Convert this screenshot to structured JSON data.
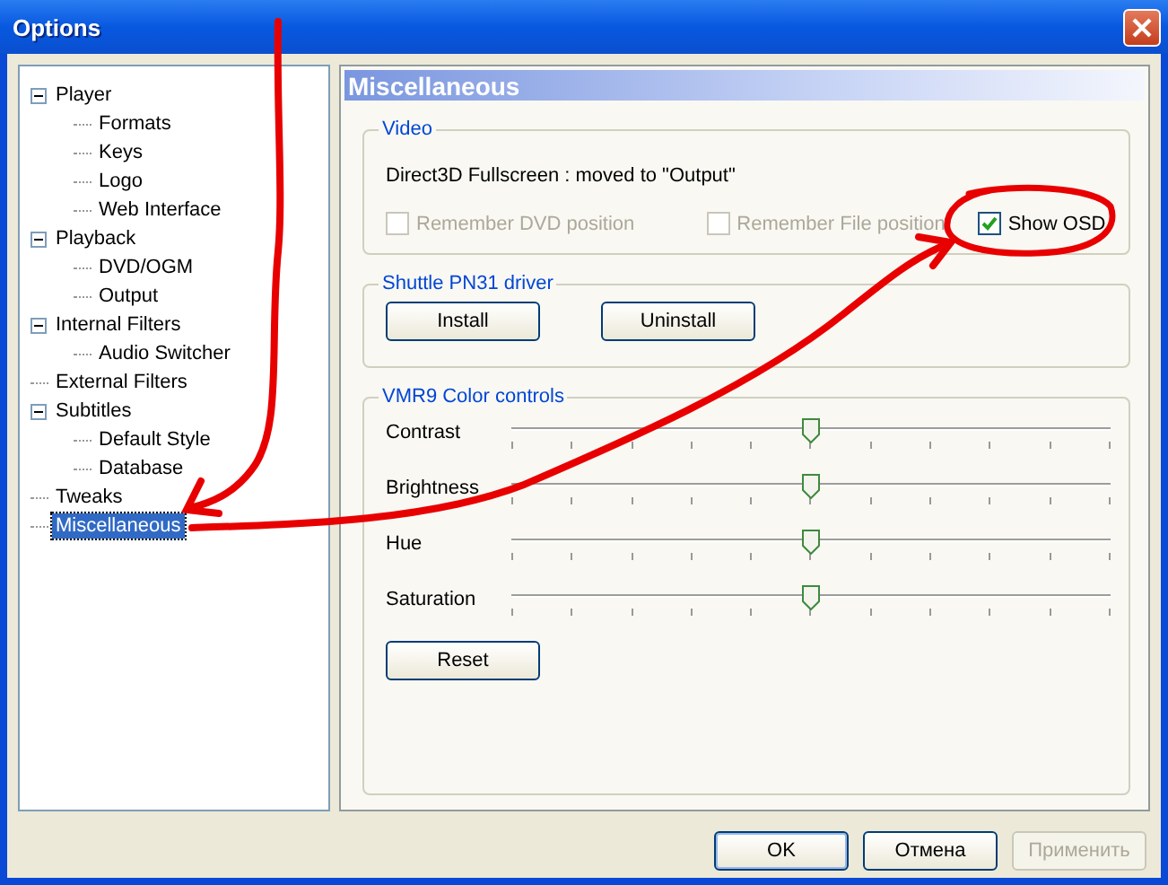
{
  "window": {
    "title": "Options"
  },
  "tree": [
    {
      "label": "Player",
      "expanded": true,
      "selected": false,
      "children": [
        {
          "label": "Formats",
          "selected": false
        },
        {
          "label": "Keys",
          "selected": false
        },
        {
          "label": "Logo",
          "selected": false
        },
        {
          "label": "Web Interface",
          "selected": false
        }
      ]
    },
    {
      "label": "Playback",
      "expanded": true,
      "selected": false,
      "children": [
        {
          "label": "DVD/OGM",
          "selected": false
        },
        {
          "label": "Output",
          "selected": false
        }
      ]
    },
    {
      "label": "Internal Filters",
      "expanded": true,
      "selected": false,
      "children": [
        {
          "label": "Audio Switcher",
          "selected": false
        }
      ]
    },
    {
      "label": "External Filters",
      "selected": false
    },
    {
      "label": "Subtitles",
      "expanded": true,
      "selected": false,
      "children": [
        {
          "label": "Default Style",
          "selected": false
        },
        {
          "label": "Database",
          "selected": false
        }
      ]
    },
    {
      "label": "Tweaks",
      "selected": false
    },
    {
      "label": "Miscellaneous",
      "selected": true
    }
  ],
  "page": {
    "title": "Miscellaneous",
    "video": {
      "title": "Video",
      "note": "Direct3D Fullscreen : moved to \"Output\"",
      "checkboxes": [
        {
          "label": "Remember DVD position",
          "checked": false,
          "disabled": true
        },
        {
          "label": "Remember File position",
          "checked": false,
          "disabled": true
        },
        {
          "label": "Show OSD",
          "checked": true,
          "disabled": false
        }
      ]
    },
    "shuttle": {
      "title": "Shuttle PN31 driver",
      "buttons": [
        "Install",
        "Uninstall"
      ]
    },
    "color": {
      "title": "VMR9 Color controls",
      "sliders": [
        {
          "label": "Contrast",
          "level": 0.5
        },
        {
          "label": "Brightness",
          "level": 0.5
        },
        {
          "label": "Hue",
          "level": 0.5
        },
        {
          "label": "Saturation",
          "level": 0.5
        }
      ],
      "reset": "Reset"
    }
  },
  "buttons": [
    {
      "label": "OK",
      "disabled": false,
      "default": true
    },
    {
      "label": "Отмена",
      "disabled": false,
      "default": false
    },
    {
      "label": "Применить",
      "disabled": true,
      "default": false
    }
  ]
}
